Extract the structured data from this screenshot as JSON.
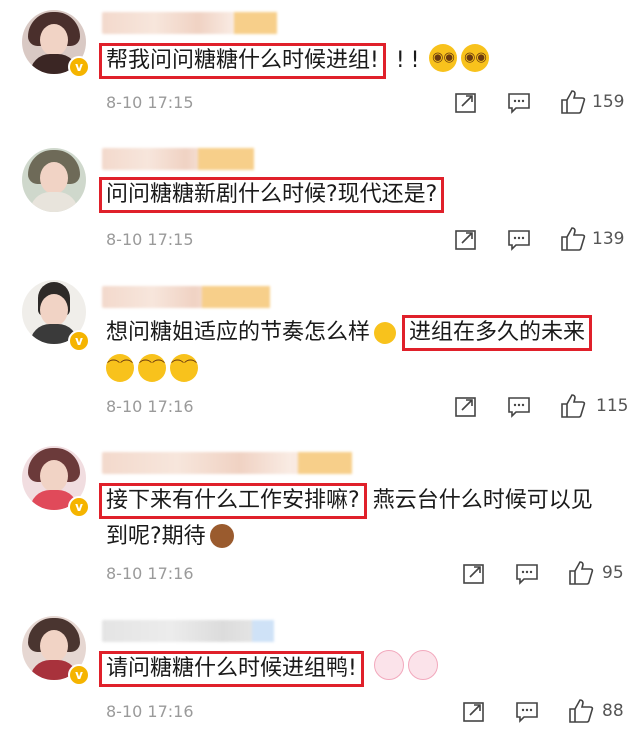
{
  "comments": [
    {
      "text_boxed": "帮我问问糖糖什么时候进组!",
      "text_rest": "!!",
      "time": "8-10 17:15",
      "likes": "159",
      "reactions": [
        "scream-emoji",
        "scream-emoji"
      ]
    },
    {
      "text_boxed": "问问糖糖新剧什么时候?现代还是?",
      "text_rest": "",
      "time": "8-10 17:15",
      "likes": "139",
      "reactions": []
    },
    {
      "text_plain": "想问糖姐适应的节奏怎么样",
      "text_boxed": "进组在多久的未来",
      "time": "8-10 17:16",
      "likes": "115",
      "reactions": [
        "laugh-cry-emoji",
        "laugh-cry-emoji",
        "laugh-cry-emoji"
      ]
    },
    {
      "text_boxed": "接下来有什么工作安排嘛?",
      "text_rest": "燕云台什么时候可以见",
      "text_line2": "到呢?期待",
      "time": "8-10 17:16",
      "likes": "95",
      "reactions": [
        "monkey-emoji"
      ]
    },
    {
      "text_boxed": "请问糖糖什么时候进组鸭!",
      "text_rest": "",
      "time": "8-10 17:16",
      "likes": "88",
      "reactions": [
        "bunny-emoji",
        "bunny-emoji"
      ]
    }
  ],
  "icons": {
    "verified": "verified-badge-icon",
    "share": "share-icon",
    "comment": "comment-icon",
    "like": "thumbs-up-icon"
  },
  "colors": {
    "highlight_box": "#e0202a",
    "verified_badge": "#f5b400",
    "meta_text": "#9a9a9a"
  }
}
